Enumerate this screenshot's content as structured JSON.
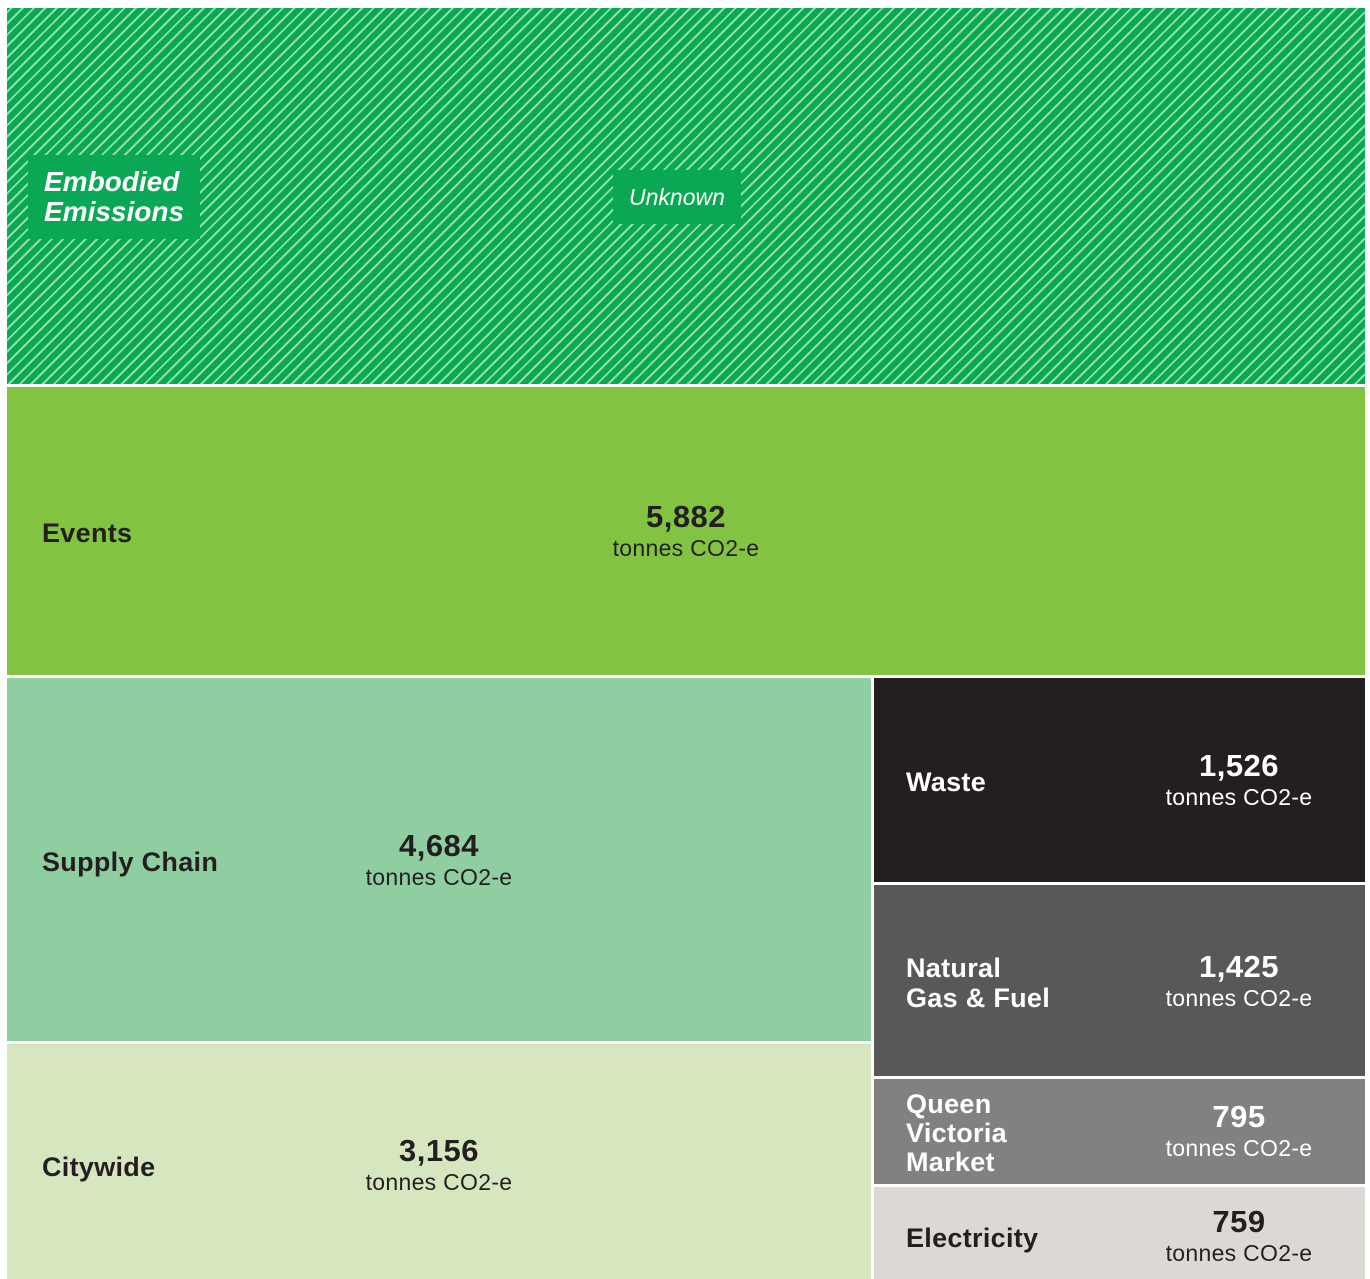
{
  "chart_data": {
    "type": "treemap",
    "unit": "tonnes CO2-e",
    "items": [
      {
        "name": "Embodied Emissions",
        "value_label": "Unknown",
        "color": "#0aa855",
        "pattern": "diagonal-hatch"
      },
      {
        "name": "Events",
        "value": 5882,
        "value_label": "5,882",
        "unit": "tonnes CO2-e",
        "color": "#82c341",
        "text_color": "#231f20"
      },
      {
        "name": "Supply Chain",
        "value": 4684,
        "value_label": "4,684",
        "unit": "tonnes CO2-e",
        "color": "#8fcea1",
        "text_color": "#231f20"
      },
      {
        "name": "Citywide",
        "value": 3156,
        "value_label": "3,156",
        "unit": "tonnes CO2-e",
        "color": "#d6e7c0",
        "text_color": "#231f20"
      },
      {
        "name": "Waste",
        "value": 1526,
        "value_label": "1,526",
        "unit": "tonnes CO2-e",
        "color": "#231f20",
        "text_color": "#ffffff"
      },
      {
        "name": "Natural Gas & Fuel",
        "value": 1425,
        "value_label": "1,425",
        "unit": "tonnes CO2-e",
        "color": "#58585a",
        "text_color": "#ffffff"
      },
      {
        "name": "Queen Victoria Market",
        "value": 795,
        "value_label": "795",
        "unit": "tonnes CO2-e",
        "color": "#818083",
        "text_color": "#ffffff"
      },
      {
        "name": "Electricity",
        "value": 759,
        "value_label": "759",
        "unit": "tonnes CO2-e",
        "color": "#dcd9d5",
        "text_color": "#231f20"
      }
    ]
  },
  "labels": {
    "embodied_title": "Embodied\nEmissions",
    "embodied_value": "Unknown",
    "events": "Events",
    "supply_chain": "Supply Chain",
    "citywide": "Citywide",
    "waste": "Waste",
    "natural_gas_fuel": "Natural\nGas & Fuel",
    "qvm": "Queen\nVictoria\nMarket",
    "electricity": "Electricity",
    "unit": "tonnes CO2-e"
  }
}
